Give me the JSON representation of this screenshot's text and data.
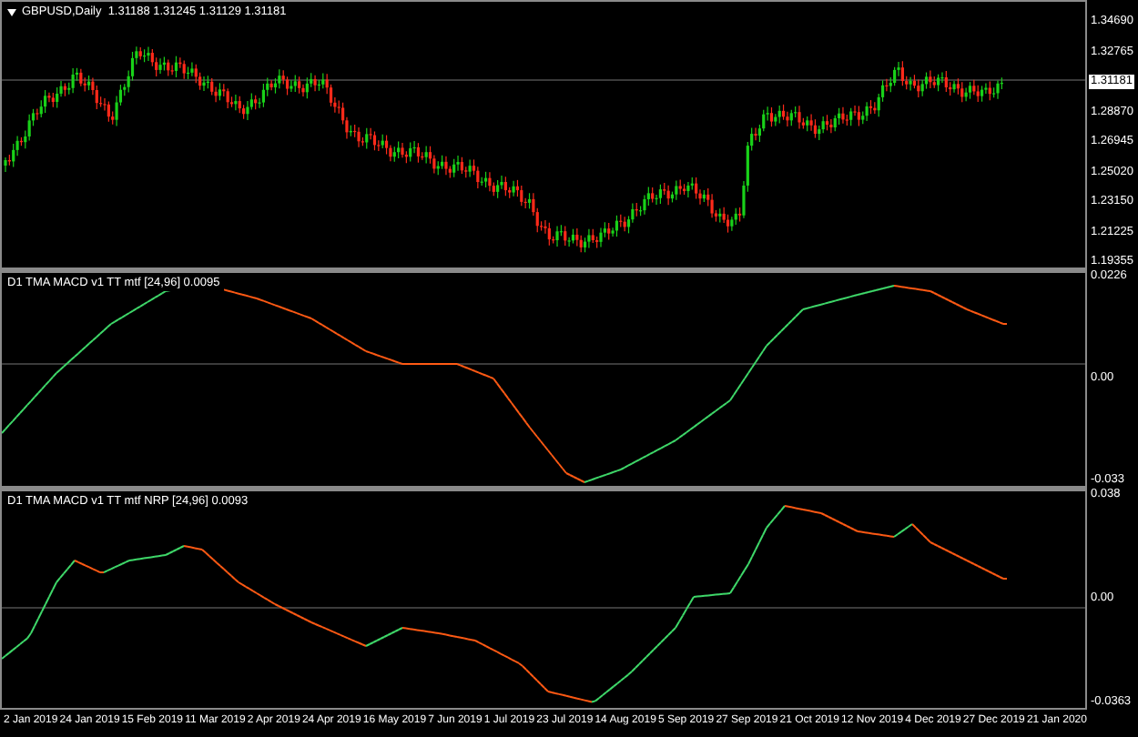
{
  "main_chart": {
    "symbol_label": "GBPUSD,Daily  1.31188 1.31245 1.31129 1.31181",
    "current_price": "1.31181",
    "price_axis": [
      "1.34690",
      "1.32765",
      "1.28870",
      "1.26945",
      "1.25020",
      "1.23150",
      "1.21225",
      "1.19355"
    ]
  },
  "indicators": [
    {
      "label": "D1 TMA MACD v1 TT mtf [24,96] 0.0095",
      "axis": [
        "0.0226",
        "0.00",
        "-0.033"
      ]
    },
    {
      "label": "D1 TMA MACD v1 TT mtf NRP [24,96] 0.0093",
      "axis": [
        "0.038",
        "0.00",
        "-0.0363"
      ]
    }
  ],
  "time_axis": [
    "2 Jan 2019",
    "24 Jan 2019",
    "15 Feb 2019",
    "11 Mar 2019",
    "2 Apr 2019",
    "24 Apr 2019",
    "16 May 2019",
    "7 Jun 2019",
    "1 Jul 2019",
    "23 Jul 2019",
    "14 Aug 2019",
    "5 Sep 2019",
    "27 Sep 2019",
    "21 Oct 2019",
    "12 Nov 2019",
    "4 Dec 2019",
    "27 Dec 2019",
    "21 Jan 2020"
  ]
}
